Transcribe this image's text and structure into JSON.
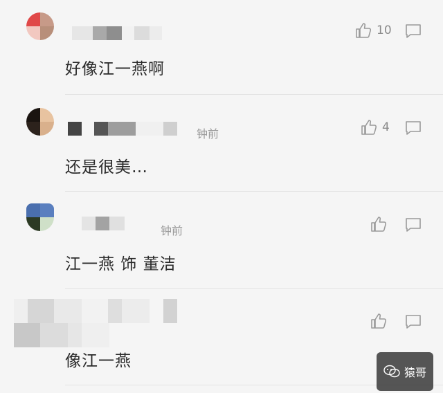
{
  "comments": [
    {
      "text": "好像江一燕啊",
      "time": "",
      "likes": "10",
      "avatar_colors": [
        "#e04848",
        "#c79a88",
        "#f2c8c0",
        "#b88f7a"
      ]
    },
    {
      "text": "还是很美…",
      "time": "钟前",
      "likes": "4",
      "avatar_colors": [
        "#1a1410",
        "#e8c3a0",
        "#2c221c",
        "#d9b08c"
      ]
    },
    {
      "text": "江一燕 饰 董洁",
      "time": "钟前",
      "likes": "",
      "avatar_colors": [
        "#4a6fae",
        "#5a7fbf",
        "#2c3a24",
        "#cfe0c8"
      ]
    },
    {
      "text": "像江一燕",
      "time": "",
      "likes": "",
      "avatar_colors": [
        "#c9c9c9",
        "#d8d8d8",
        "#bdbdbd",
        "#e3e3e3"
      ]
    }
  ],
  "watermark": {
    "label": "猿哥"
  },
  "icons": {
    "like": "thumbs-up-icon",
    "reply": "speech-bubble-icon"
  }
}
